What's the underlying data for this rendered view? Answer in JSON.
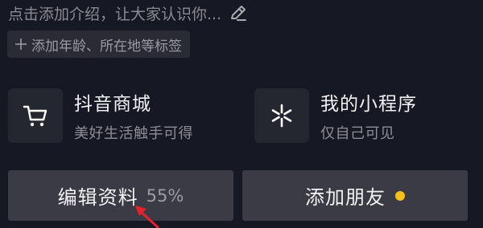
{
  "profile": {
    "intro_placeholder": "点击添加介绍，让大家认识你...",
    "tag_prompt": "添加年龄、所在地等标签"
  },
  "services": [
    {
      "title": "抖音商城",
      "subtitle": "美好生活触手可得",
      "icon": "shopping-cart-icon"
    },
    {
      "title": "我的小程序",
      "subtitle": "仅自己可见",
      "icon": "mini-program-icon"
    }
  ],
  "actions": {
    "edit_profile_label": "编辑资料",
    "profile_completion": "55%",
    "add_friend_label": "添加朋友"
  },
  "colors": {
    "background": "#161823",
    "button_bg": "#3a3b44",
    "notification_dot": "#f3c11a",
    "annotation_arrow": "#e8212b"
  }
}
